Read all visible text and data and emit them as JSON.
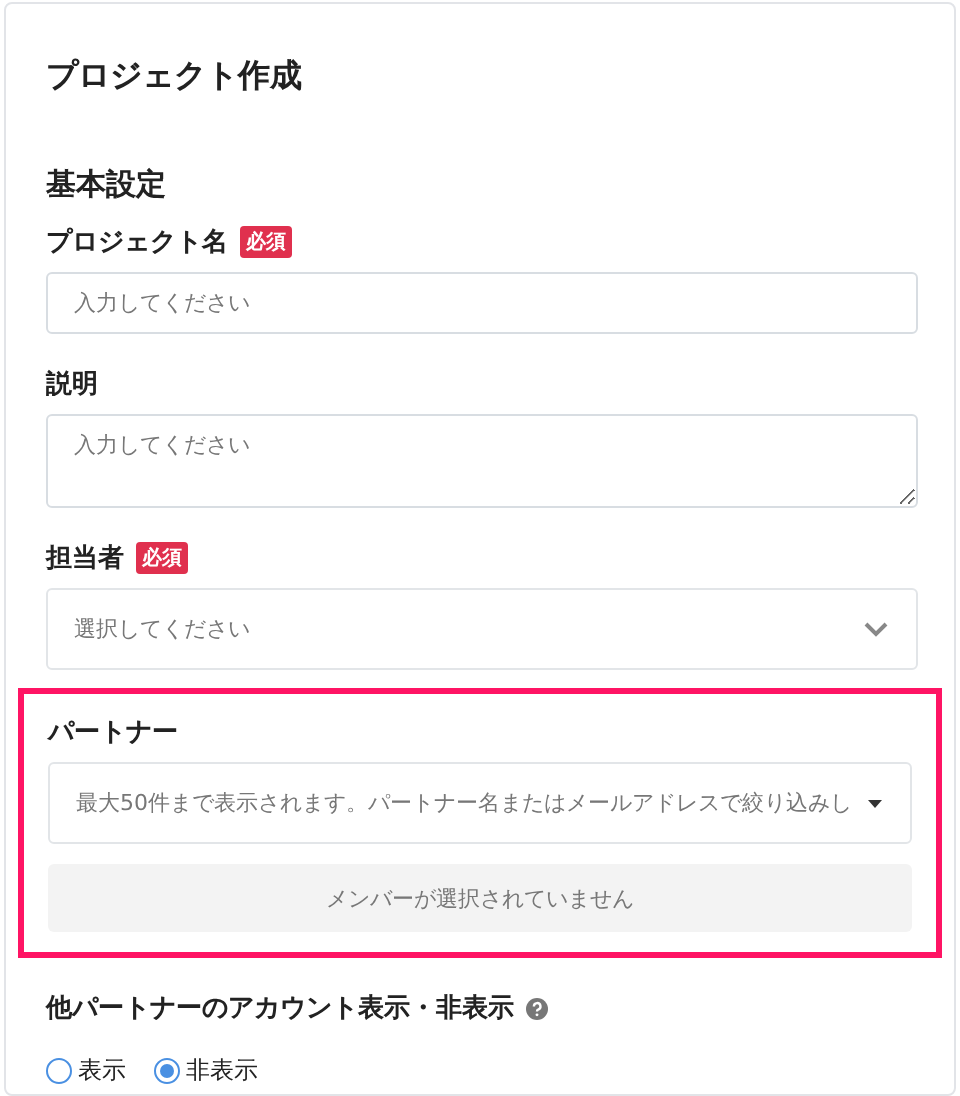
{
  "title": "プロジェクト作成",
  "section": "基本設定",
  "fields": [
    {
      "kind": "input",
      "label": "プロジェクト名",
      "required": true,
      "badge": "必須",
      "placeholder": "入力してください"
    },
    {
      "kind": "textarea",
      "label": "説明",
      "required": false,
      "placeholder": "入力してください"
    },
    {
      "kind": "select",
      "label": "担当者",
      "required": true,
      "badge": "必須",
      "placeholder": "選択してください"
    }
  ],
  "partner": {
    "label": "パートナー",
    "highlighted": true,
    "placeholder": "最大50件まで表示されます。パートナー名またはメールアドレスで絞り込みし",
    "empty_message": "メンバーが選択されていません"
  },
  "visibility": {
    "label": "他パートナーのアカウント表示・非表示",
    "options": [
      {
        "label": "表示",
        "selected": false
      },
      {
        "label": "非表示",
        "selected": true
      }
    ]
  }
}
